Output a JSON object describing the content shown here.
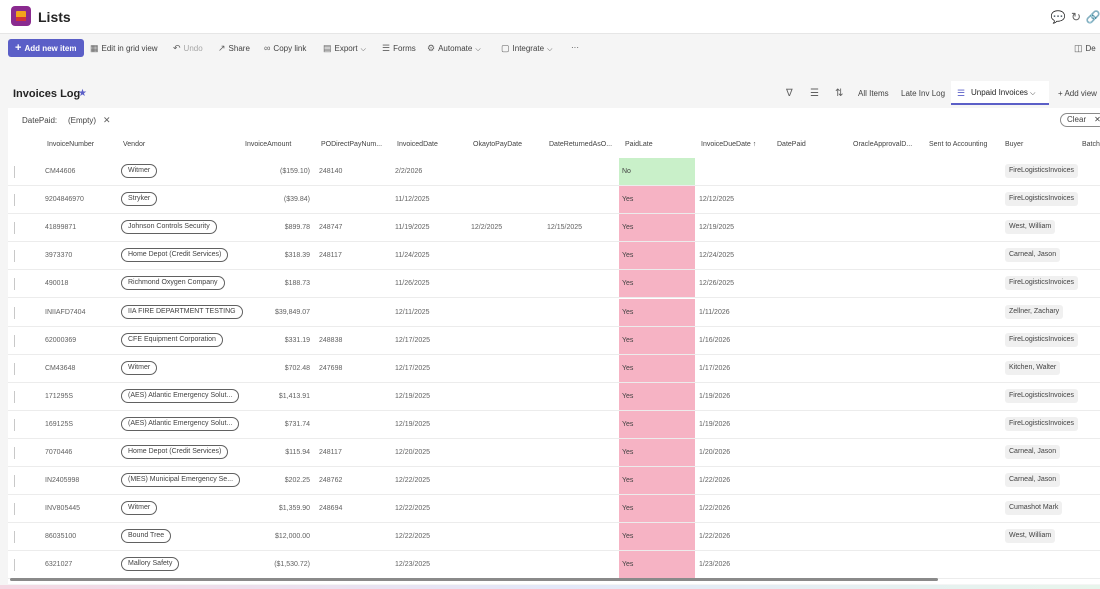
{
  "app": {
    "title": "Lists"
  },
  "toolbar": {
    "add_new_item": "Add new item",
    "edit_grid": "Edit in grid view",
    "undo": "Undo",
    "share": "Share",
    "copy_link": "Copy link",
    "export": "Export",
    "forms": "Forms",
    "automate": "Automate",
    "integrate": "Integrate",
    "more": "···",
    "details_partial": "De"
  },
  "list": {
    "title": "Invoices Log"
  },
  "views": {
    "all_items": "All Items",
    "late_inv_log": "Late Inv Log",
    "unpaid_invoices": "Unpaid Invoices",
    "add_view": "Add view"
  },
  "filter": {
    "label": "DatePaid:",
    "value": "(Empty)",
    "clear": "Clear"
  },
  "columns": {
    "invoice_number": "InvoiceNumber",
    "vendor": "Vendor",
    "invoice_amount": "InvoiceAmount",
    "po": "PODirectPayNum...",
    "invoiced_date": "InvoicedDate",
    "okay_to_pay": "OkaytoPayDate",
    "date_returned": "DateReturnedAsO...",
    "paid_late": "PaidLate",
    "due_date": "InvoiceDueDate",
    "date_paid": "DatePaid",
    "oracle": "OracleApprovalD...",
    "sent": "Sent to Accounting",
    "buyer": "Buyer",
    "batch": "Batch"
  },
  "rows": [
    {
      "inv": "CM44606",
      "vendor": "Witmer",
      "amount": "($159.10)",
      "po": "248140",
      "invoiced": "2/2/2026",
      "okay": "",
      "returned": "",
      "paid_late": "No",
      "due": "",
      "buyer": "FireLogisticsInvoices"
    },
    {
      "inv": "9204846970",
      "vendor": "Stryker",
      "amount": "($39.84)",
      "po": "",
      "invoiced": "11/12/2025",
      "okay": "",
      "returned": "",
      "paid_late": "Yes",
      "due": "12/12/2025",
      "buyer": "FireLogisticsInvoices"
    },
    {
      "inv": "41899871",
      "vendor": "Johnson Controls Security",
      "amount": "$899.78",
      "po": "248747",
      "invoiced": "11/19/2025",
      "okay": "12/2/2025",
      "returned": "12/15/2025",
      "paid_late": "Yes",
      "due": "12/19/2025",
      "buyer": "West, William"
    },
    {
      "inv": "3973370",
      "vendor": "Home Depot (Credit Services)",
      "amount": "$318.39",
      "po": "248117",
      "invoiced": "11/24/2025",
      "okay": "",
      "returned": "",
      "paid_late": "Yes",
      "due": "12/24/2025",
      "buyer": "Carneal, Jason"
    },
    {
      "inv": "490018",
      "vendor": "Richmond Oxygen Company",
      "amount": "$188.73",
      "po": "",
      "invoiced": "11/26/2025",
      "okay": "",
      "returned": "",
      "paid_late": "Yes",
      "due": "12/26/2025",
      "buyer": "FireLogisticsInvoices"
    },
    {
      "inv": "INIIAFD7404",
      "vendor": "IIA FIRE DEPARTMENT TESTING",
      "amount": "$39,849.07",
      "po": "",
      "invoiced": "12/11/2025",
      "okay": "",
      "returned": "",
      "paid_late": "Yes",
      "due": "1/11/2026",
      "buyer": "Zellner, Zachary"
    },
    {
      "inv": "62000369",
      "vendor": "CFE Equipment Corporation",
      "amount": "$331.19",
      "po": "248838",
      "invoiced": "12/17/2025",
      "okay": "",
      "returned": "",
      "paid_late": "Yes",
      "due": "1/16/2026",
      "buyer": "FireLogisticsInvoices"
    },
    {
      "inv": "CM43648",
      "vendor": "Witmer",
      "amount": "$702.48",
      "po": "247698",
      "invoiced": "12/17/2025",
      "okay": "",
      "returned": "",
      "paid_late": "Yes",
      "due": "1/17/2026",
      "buyer": "Kitchen, Walter"
    },
    {
      "inv": "171295S",
      "vendor": "(AES) Atlantic Emergency Solut...",
      "amount": "$1,413.91",
      "po": "",
      "invoiced": "12/19/2025",
      "okay": "",
      "returned": "",
      "paid_late": "Yes",
      "due": "1/19/2026",
      "buyer": "FireLogisticsInvoices"
    },
    {
      "inv": "169125S",
      "vendor": "(AES) Atlantic Emergency Solut...",
      "amount": "$731.74",
      "po": "",
      "invoiced": "12/19/2025",
      "okay": "",
      "returned": "",
      "paid_late": "Yes",
      "due": "1/19/2026",
      "buyer": "FireLogisticsInvoices"
    },
    {
      "inv": "7070446",
      "vendor": "Home Depot (Credit Services)",
      "amount": "$115.94",
      "po": "248117",
      "invoiced": "12/20/2025",
      "okay": "",
      "returned": "",
      "paid_late": "Yes",
      "due": "1/20/2026",
      "buyer": "Carneal, Jason"
    },
    {
      "inv": "IN2405998",
      "vendor": "(MES) Municipal Emergency Se...",
      "amount": "$202.25",
      "po": "248762",
      "invoiced": "12/22/2025",
      "okay": "",
      "returned": "",
      "paid_late": "Yes",
      "due": "1/22/2026",
      "buyer": "Carneal, Jason"
    },
    {
      "inv": "INV805445",
      "vendor": "Witmer",
      "amount": "$1,359.90",
      "po": "248694",
      "invoiced": "12/22/2025",
      "okay": "",
      "returned": "",
      "paid_late": "Yes",
      "due": "1/22/2026",
      "buyer": "Cumashot Mark"
    },
    {
      "inv": "86035100",
      "vendor": "Bound Tree",
      "amount": "$12,000.00",
      "po": "",
      "invoiced": "12/22/2025",
      "okay": "",
      "returned": "",
      "paid_late": "Yes",
      "due": "1/22/2026",
      "buyer": "West, William"
    },
    {
      "inv": "6321027",
      "vendor": "Mallory Safety",
      "amount": "($1,530.72)",
      "po": "",
      "invoiced": "12/23/2025",
      "okay": "",
      "returned": "",
      "paid_late": "Yes",
      "due": "1/23/2026",
      "buyer": ""
    }
  ]
}
